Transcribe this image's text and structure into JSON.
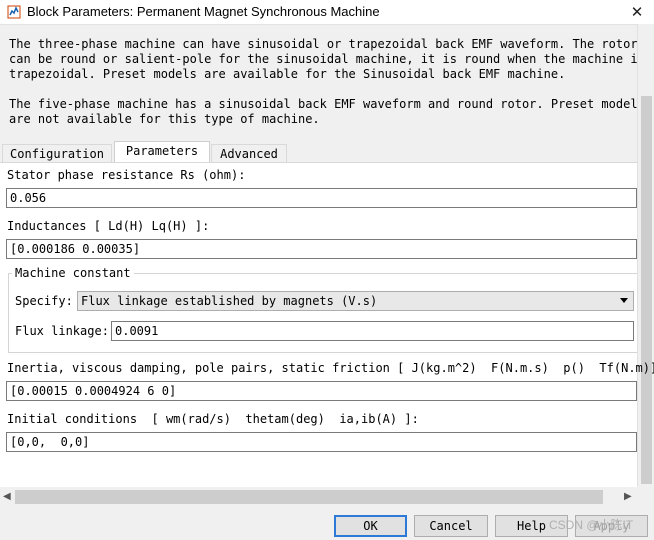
{
  "window": {
    "title": "Block Parameters: Permanent Magnet Synchronous Machine",
    "close_glyph": "✕"
  },
  "description": {
    "lines": [
      "The three-phase machine can have sinusoidal or trapezoidal back EMF waveform. The rotor",
      "can be round or salient-pole for the sinusoidal machine, it is round when the machine is",
      "trapezoidal. Preset models are available for the Sinusoidal back EMF machine.",
      "",
      "The five-phase machine has a sinusoidal back EMF waveform and round rotor. Preset models",
      "are not available for this type of machine."
    ]
  },
  "tabs": [
    {
      "label": "Configuration",
      "active": false
    },
    {
      "label": "Parameters",
      "active": true
    },
    {
      "label": "Advanced",
      "active": false
    }
  ],
  "params": {
    "stator_resistance": {
      "label": "Stator phase resistance Rs (ohm):",
      "value": "0.056"
    },
    "inductances": {
      "label": "Inductances [ Ld(H) Lq(H) ]:",
      "value": "[0.000186 0.00035]"
    },
    "machine_constant": {
      "group_label": "Machine constant",
      "specify_label": "Specify:",
      "specify_value": "Flux linkage established by magnets (V.s)",
      "flux_label": "Flux linkage:",
      "flux_value": "0.0091"
    },
    "inertia": {
      "label": "Inertia, viscous damping, pole pairs, static friction [ J(kg.m^2)  F(N.m.s)  p()  Tf(N.m)]",
      "value": "[0.00015 0.0004924 6 0]"
    },
    "initial_conditions": {
      "label": "Initial conditions  [ wm(rad/s)  thetam(deg)  ia,ib(A) ]:",
      "value": "[0,0,  0,0]"
    }
  },
  "buttons": {
    "ok": "OK",
    "cancel": "Cancel",
    "help": "Help",
    "apply": "Apply"
  },
  "watermark": "CSDN @小陈IT",
  "icons": {
    "window": "simulink-block-icon",
    "close": "close-icon",
    "dropdown": "chevron-down-icon"
  }
}
